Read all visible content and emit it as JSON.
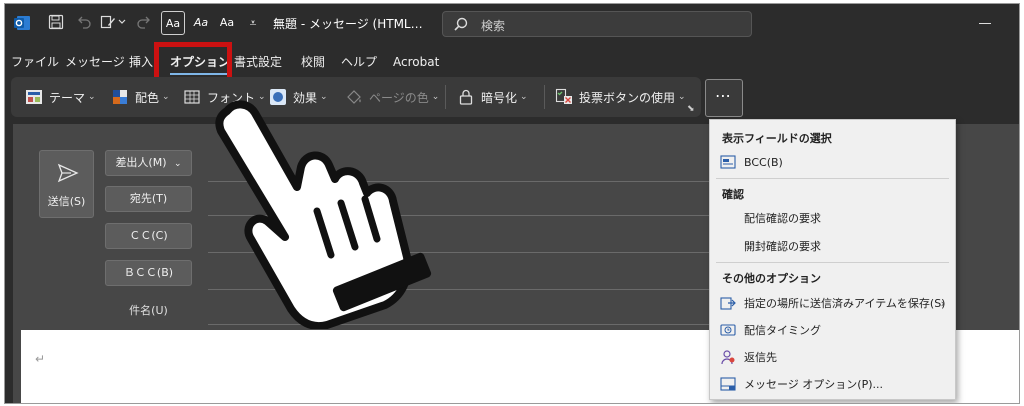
{
  "titlebar": {
    "doc_title": "無題 - メッセージ (HTML…",
    "search_placeholder": "検索",
    "font_buttons": [
      "Aa",
      "Aa",
      "Aa"
    ],
    "qat_more": "⩡"
  },
  "menu": {
    "tabs": [
      "ファイル",
      "メッセージ",
      "挿入",
      "オプション",
      "書式設定",
      "校閲",
      "ヘルプ",
      "Acrobat"
    ],
    "active_tab": "オプション"
  },
  "ribbon": {
    "theme": "テーマ",
    "colors": "配色",
    "fonts": "フォント",
    "effects": "効果",
    "page_color": "ページの色",
    "encrypt": "暗号化",
    "voting": "投票ボタンの使用",
    "more": "⋯"
  },
  "compose": {
    "send": "送信(S)",
    "from": "差出人(M)",
    "to": "宛先(T)",
    "cc": "ＣＣ(C)",
    "bcc": "ＢＣＣ(B)",
    "subject": "件名(U)",
    "para_mark": "↵"
  },
  "dropdown": {
    "show_fields_header": "表示フィールドの選択",
    "bcc_item": "BCC(B)",
    "confirm_header": "確認",
    "delivery_receipt": "配信確認の要求",
    "read_receipt": "開封確認の要求",
    "other_header": "その他のオプション",
    "save_sent": "指定の場所に送信済みアイテムを保存(S)",
    "delay_delivery": "配信タイミング",
    "reply_to": "返信先",
    "message_options": "メッセージ オプション(P)..."
  },
  "colors": {
    "frame_bg": "#2c2c2c",
    "ribbon_bg": "#3a3a3a",
    "compose_bg": "#474747",
    "accent_underline": "#7fb6e8",
    "highlight_red": "#cc1111",
    "dropdown_bg": "#f0f0f0"
  }
}
